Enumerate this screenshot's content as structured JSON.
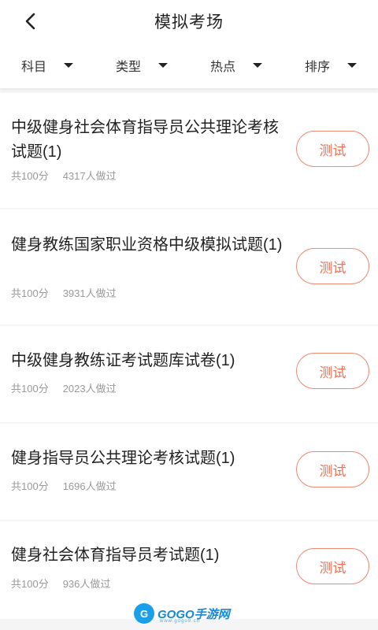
{
  "header": {
    "title": "模拟考场"
  },
  "filters": [
    {
      "label": "科目"
    },
    {
      "label": "类型"
    },
    {
      "label": "热点"
    },
    {
      "label": "排序"
    }
  ],
  "exams": [
    {
      "title": "中级健身社会体育指导员公共理论考核试题(1)",
      "score": "共100分",
      "participants": "4317人做过",
      "button": "测试"
    },
    {
      "title": "健身教练国家职业资格中级模拟试题(1)",
      "score": "共100分",
      "participants": "3931人做过",
      "button": "测试"
    },
    {
      "title": "中级健身教练证考试题库试卷(1)",
      "score": "共100分",
      "participants": "2023人做过",
      "button": "测试"
    },
    {
      "title": "健身指导员公共理论考核试题(1)",
      "score": "共100分",
      "participants": "1696人做过",
      "button": "测试"
    },
    {
      "title": "健身社会体育指导员考试题(1)",
      "score": "共100分",
      "participants": "936人做过",
      "button": "测试"
    }
  ],
  "watermark": {
    "brand": "GOGO手游网",
    "sub": "www.gogo9.cn"
  },
  "colors": {
    "accent": "#ea7158",
    "accent_border": "#ef8a75",
    "meta": "#999999",
    "watermark": "#1688d8"
  }
}
